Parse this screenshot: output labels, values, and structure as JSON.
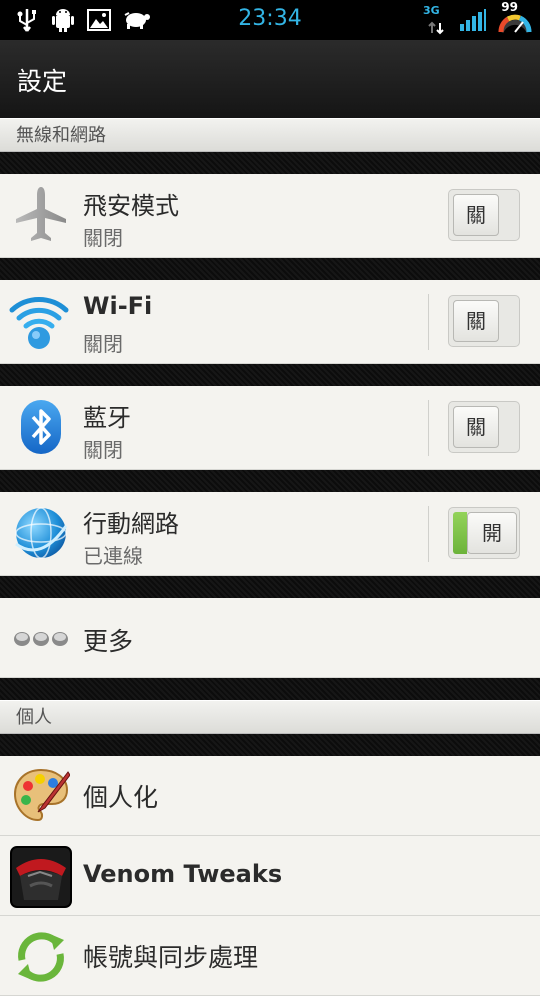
{
  "status_bar": {
    "time": "23:34",
    "network_type": "3G",
    "battery_percent": "99",
    "icons": [
      "usb-icon",
      "android-debug-icon",
      "image-notification-icon",
      "app-notification-icon",
      "data-activity-icon",
      "signal-icon",
      "battery-icon"
    ]
  },
  "action_bar": {
    "title": "設定"
  },
  "sections": {
    "wireless": {
      "header": "無線和網路"
    },
    "personal": {
      "header": "個人"
    }
  },
  "items": {
    "airplane": {
      "title": "飛安模式",
      "summary": "關閉",
      "toggle_label": "關",
      "on": false
    },
    "wifi": {
      "title": "Wi-Fi",
      "summary": "關閉",
      "toggle_label": "關",
      "on": false
    },
    "bluetooth": {
      "title": "藍牙",
      "summary": "關閉",
      "toggle_label": "關",
      "on": false
    },
    "mobile_network": {
      "title": "行動網路",
      "summary": "已連線",
      "toggle_label": "開",
      "on": true
    },
    "more": {
      "title": "更多"
    },
    "personalize": {
      "title": "個人化"
    },
    "venom": {
      "title": "Venom Tweaks"
    },
    "accounts_sync": {
      "title": "帳號與同步處理"
    }
  },
  "colors": {
    "accent": "#33b5e5",
    "toggle_on": "#7cc346",
    "list_bg": "#f4f3ef"
  }
}
